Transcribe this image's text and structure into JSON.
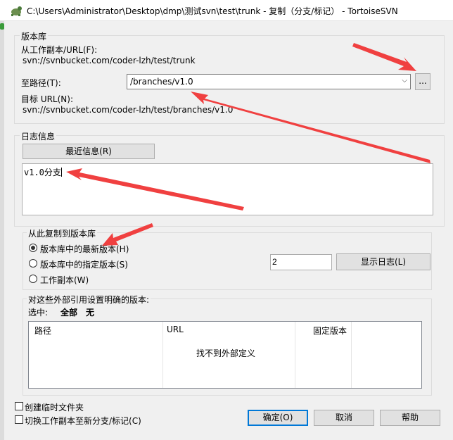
{
  "window": {
    "title": "C:\\Users\\Administrator\\Desktop\\dmp\\测试svn\\test\\trunk - 复制（分支/标记） - TortoiseSVN"
  },
  "repository": {
    "group_title": "版本库",
    "from_label": "从工作副本/URL(F):",
    "from_url": "svn://svnbucket.com/coder-lzh/test/trunk",
    "to_path_label": "至路径(T):",
    "to_path_value": "/branches/v1.0",
    "browse_label": "...",
    "target_label": "目标 URL(N):",
    "target_url": "svn://svnbucket.com/coder-lzh/test/branches/v1.0"
  },
  "log": {
    "group_title": "日志信息",
    "recent_button": "最近信息(R)",
    "message": "v1.0分支"
  },
  "copy_from": {
    "group_title": "从此复制到版本库",
    "options": [
      {
        "label": "版本库中的最新版本(H)",
        "checked": true
      },
      {
        "label": "版本库中的指定版本(S)",
        "checked": false
      },
      {
        "label": "工作副本(W)",
        "checked": false
      }
    ],
    "revision_value": "2",
    "show_log_button": "显示日志(L)"
  },
  "externals": {
    "group_title": "对这些外部引用设置明确的版本:",
    "select_label": "选中:",
    "select_all": "全部",
    "select_none": "无",
    "columns": [
      "路径",
      "URL",
      "固定版本"
    ],
    "empty_text": "找不到外部定义"
  },
  "options": {
    "create_intermediate": "创建临时文件夹",
    "switch_working_copy": "切换工作副本至新分支/标记(C)"
  },
  "buttons": {
    "ok": "确定(O)",
    "cancel": "取消",
    "help": "帮助"
  },
  "colors": {
    "annotation_arrow": "#f04040",
    "default_button_border": "#0078d7"
  }
}
